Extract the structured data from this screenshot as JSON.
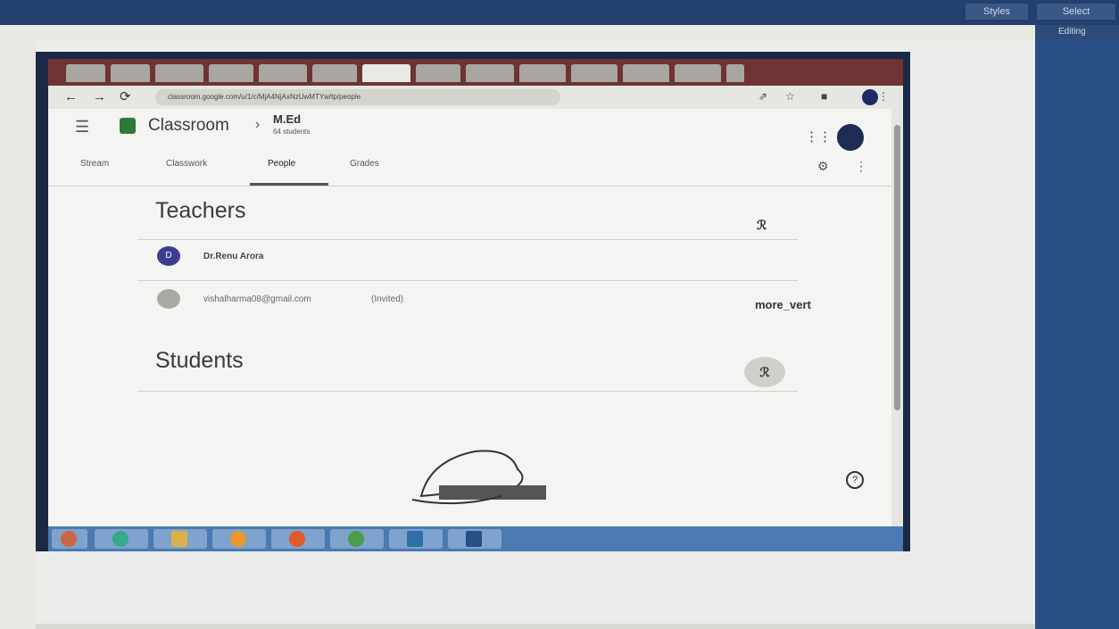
{
  "word": {
    "styles_label": "Styles",
    "select_label": "Select",
    "styles_group": "Styles",
    "editing_group": "Editing"
  },
  "browser": {
    "url": "classroom.google.com/u/1/c/MjA4NjAxNzUwMTYw/tp/people"
  },
  "classroom": {
    "app_name": "Classroom",
    "class_name": "M.Ed",
    "class_sub": "64 students",
    "tabs": [
      "Stream",
      "Classwork",
      "People",
      "Grades"
    ],
    "teachers_title": "Teachers",
    "teacher_name": "Dr.Renu Arora",
    "teacher_initial": "D",
    "invited_email": "vishalharma08@gmail.com",
    "invited_tag": "(Invited)",
    "more_vert": "more_vert",
    "students_title": "Students",
    "add_icon_text": "ℛ",
    "help_text": "?"
  },
  "colors": {
    "accent": "#2f4e8a",
    "avatar": "#3a3f8f"
  }
}
